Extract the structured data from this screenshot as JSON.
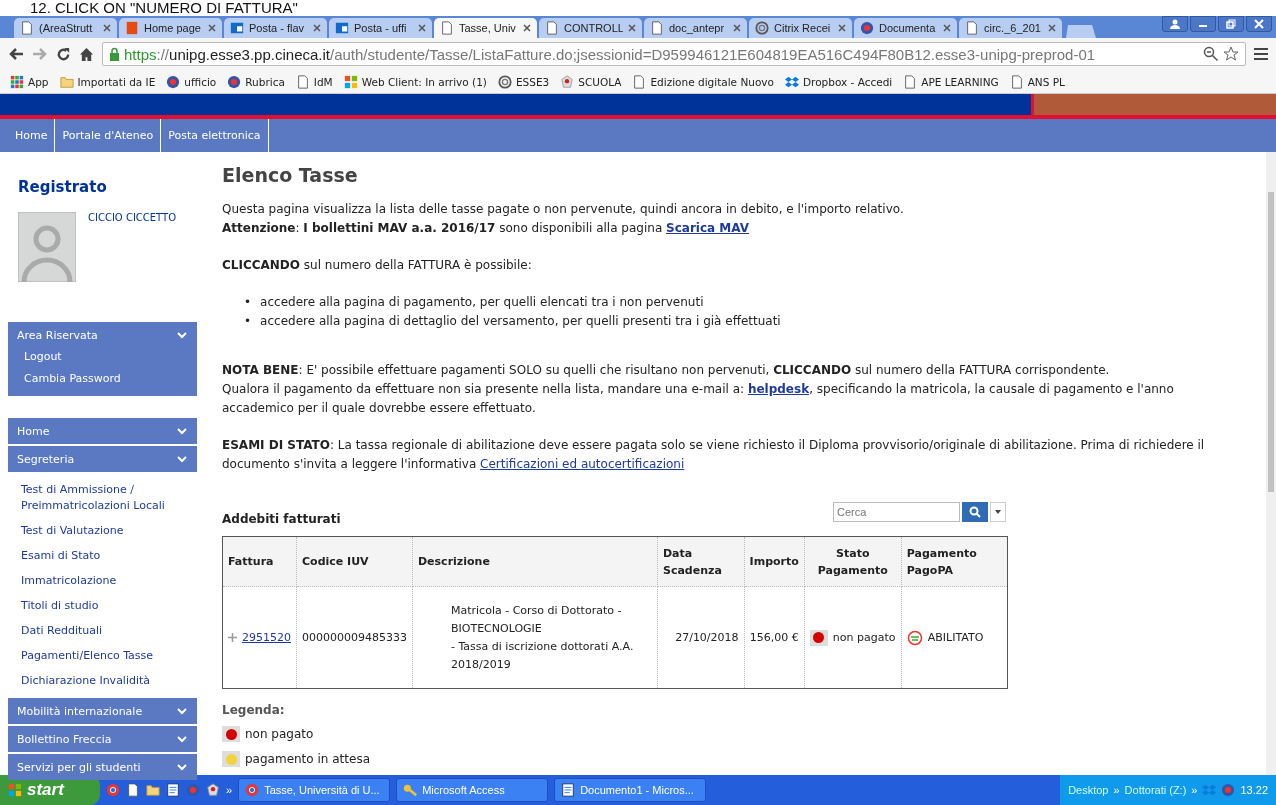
{
  "annotation": "12. CLICK ON \"NUMERO DI FATTURA\"",
  "browser": {
    "tabs": [
      {
        "label": "(AreaStrutt",
        "kind": "doc",
        "selected": false
      },
      {
        "label": "Home page",
        "kind": "office",
        "selected": false
      },
      {
        "label": "Posta - flav",
        "kind": "mail",
        "selected": false
      },
      {
        "label": "Posta - uffi",
        "kind": "mail",
        "selected": false
      },
      {
        "label": "Tasse, Univ",
        "kind": "doc",
        "selected": true
      },
      {
        "label": "CONTROLL",
        "kind": "doc",
        "selected": false
      },
      {
        "label": "doc_antepr",
        "kind": "doc",
        "selected": false
      },
      {
        "label": "Citrix Recei",
        "kind": "swirl",
        "selected": false
      },
      {
        "label": "Documenta",
        "kind": "seal",
        "selected": false
      },
      {
        "label": "circ._6_201",
        "kind": "doc",
        "selected": false
      }
    ],
    "address": {
      "scheme": "https",
      "separator": "://",
      "host": "unipg.esse3.pp.cineca.it",
      "path": "/auth/studente/Tasse/ListaFatture.do;jsessionid=D959946121E604819EA516C494F80B12.esse3-unipg-preprod-01"
    },
    "bookmarks": [
      {
        "label": "App",
        "kind": "grid"
      },
      {
        "label": "Importati da IE",
        "kind": "folder"
      },
      {
        "label": "ufficio",
        "kind": "seal"
      },
      {
        "label": "Rubrica",
        "kind": "seal"
      },
      {
        "label": "IdM",
        "kind": "doc"
      },
      {
        "label": "Web Client: In arrivo (1)",
        "kind": "windows"
      },
      {
        "label": "ESSE3",
        "kind": "swirl"
      },
      {
        "label": "SCUOLA",
        "kind": "emblem"
      },
      {
        "label": "Edizione digitale Nuovo",
        "kind": "doc"
      },
      {
        "label": "Dropbox - Accedi",
        "kind": "dropbox"
      },
      {
        "label": "APE LEARNING",
        "kind": "doc"
      },
      {
        "label": "ANS PL",
        "kind": "doc"
      }
    ]
  },
  "top_nav": [
    "Home",
    "Portale d'Ateneo",
    "Posta elettronica"
  ],
  "sidebar": {
    "title": "Registrato",
    "user": "CICCIO CICCETTO",
    "groups": [
      {
        "menus": [
          {
            "label": "Area Riservata",
            "expanded": true,
            "kind": "panel",
            "children": [
              "Logout",
              "Cambia Password"
            ]
          }
        ]
      },
      {
        "menus": [
          {
            "label": "Home"
          },
          {
            "label": "Segreteria",
            "expanded": true,
            "kind": "list",
            "children": [
              "Test di Ammissione / Preimmatricolazioni Locali",
              "Test di Valutazione",
              "Esami di Stato",
              "Immatricolazione",
              "Titoli di studio",
              "Dati Reddituali",
              "Pagamenti/Elenco Tasse",
              "Dichiarazione Invalidità"
            ]
          },
          {
            "label": "Mobilità internazionale"
          },
          {
            "label": "Bollettino Freccia"
          },
          {
            "label": "Servizi per gli studenti"
          }
        ]
      }
    ]
  },
  "main": {
    "title": "Elenco Tasse",
    "blocks": [
      {
        "kind": "paragraph",
        "lines": [
          [
            {
              "text": "Questa pagina visualizza la lista delle tasse pagate o non pervenute, quindi ancora in debito, e l'importo relativo."
            }
          ],
          [
            {
              "text": "**Attenzione**: **I bollettini MAV a.a. 2016/17** sono disponibili alla pagina "
            },
            {
              "link": "Scarica MAV",
              "bold": true
            }
          ]
        ]
      },
      {
        "kind": "paragraph",
        "lines": [
          [
            {
              "text": "**CLICCANDO** sul numero della FATTURA è possibile:"
            }
          ]
        ]
      },
      {
        "kind": "bullets",
        "marker": "•",
        "items": [
          "accedere alla pagina di pagamento, per quelli elencati tra i non pervenuti",
          "accedere alla pagina di dettaglio del versamento, per quelli presenti tra i già effettuati"
        ]
      },
      {
        "kind": "paragraph",
        "lines": [
          [
            {
              "text": "**NOTA BENE**: E' possibile effettuare pagamenti SOLO su quelli che risultano non pervenuti, **CLICCANDO** sul numero della FATTURA corrispondente."
            }
          ],
          [
            {
              "text": "Qualora il pagamento da effettuare non sia presente nella lista, mandare una e-mail a: "
            },
            {
              "link": "helpdesk",
              "bold": true
            },
            {
              "text": ", specificando la matricola, la causale di pagamento e l'anno accademico per il quale dovrebbe essere effettuato."
            }
          ]
        ]
      },
      {
        "kind": "paragraph",
        "lines": [
          [
            {
              "text": "**ESAMI DI STATO**: La tassa regionale di abilitazione deve essere pagata solo se viene richiesto il Diploma provvisorio/originale di abilitazione. Prima di richiedere il documento s'invita a leggere l'informativa "
            },
            {
              "link": "Certificazioni ed autocertificazioni",
              "bold": false
            }
          ]
        ]
      }
    ],
    "table": {
      "title": "Addebiti fatturati",
      "search": {
        "placeholder": "Cerca"
      },
      "columns": [
        "Fattura",
        "Codice IUV",
        "Descrizione",
        "Data Scadenza",
        "Importo",
        "Stato Pagamento",
        "Pagamento PagoPA"
      ],
      "rows": [
        {
          "invoice": "2951520",
          "iuv": "000000009485333",
          "description": [
            "Matricola - Corso di Dottorato - BIOTECNOLOGIE",
            "- Tassa di iscrizione dottorati A.A. 2018/2019"
          ],
          "due": "27/10/2018",
          "amount": "156,00 €",
          "status": {
            "label": "non pagato",
            "color": "#d40000"
          },
          "pagopa": "ABILITATO"
        }
      ]
    },
    "legend": {
      "title": "Legenda:",
      "items": [
        {
          "label": "non pagato",
          "color": "#d40000"
        },
        {
          "label": "pagamento in attesa",
          "color": "#f2d43a"
        }
      ]
    }
  },
  "taskbar": {
    "start": "start",
    "overflow": "»",
    "tasks": [
      {
        "label": "Tasse, Università di U...",
        "kind": "chrome"
      },
      {
        "label": "Microsoft Access",
        "kind": "key"
      },
      {
        "label": "Documento1 - Micros...",
        "kind": "word"
      }
    ],
    "toolbars": [
      "Desktop",
      "Dottorati (Z:)"
    ],
    "clock": "13.22"
  }
}
